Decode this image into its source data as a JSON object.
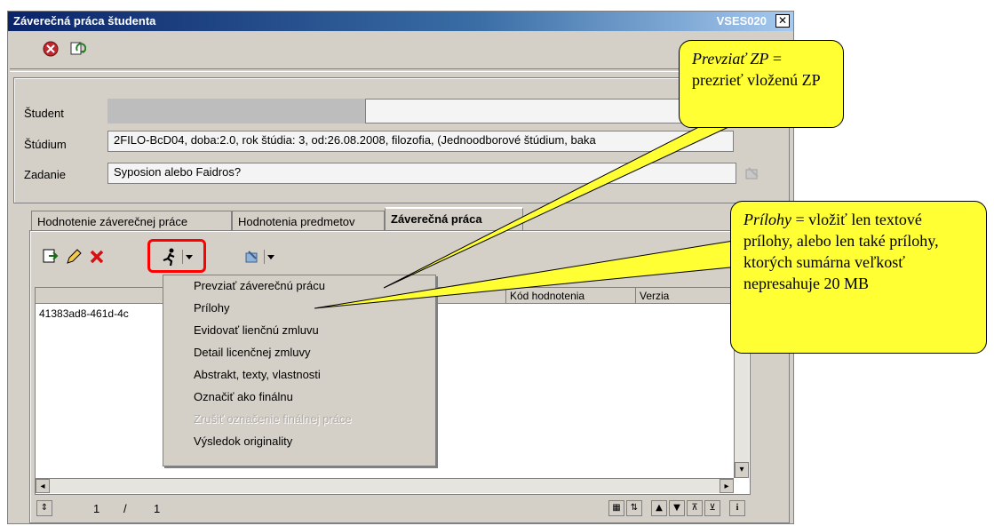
{
  "window": {
    "title": "Záverečná práca študenta",
    "code": "VSES020",
    "close_glyph": "✕"
  },
  "form": {
    "student_label": "Študent",
    "student_value": "",
    "studium_label": "Štúdium",
    "studium_value": "2FILO-BcD04, doba:2.0, rok štúdia: 3, od:26.08.2008, filozofia, (Jednoodborové štúdium, baka",
    "zadanie_label": "Zadanie",
    "zadanie_value": "Syposion alebo Faidros?"
  },
  "tabs": [
    {
      "label": "Hodnotenie záverečnej práce"
    },
    {
      "label": "Hodnotenia predmetov"
    },
    {
      "label": "Záverečná práca"
    }
  ],
  "grid": {
    "headers": [
      "",
      "ráce",
      "Kód hodnotenia",
      "Verzia"
    ],
    "row_value": "41383ad8-461d-4c"
  },
  "menu": {
    "items": [
      {
        "label": "Prevziať záverečnú prácu",
        "enabled": true
      },
      {
        "label": "Prílohy",
        "enabled": true
      },
      {
        "label": "Evidovať lienčnú zmluvu",
        "enabled": true
      },
      {
        "label": "Detail licenčnej zmluvy",
        "enabled": true
      },
      {
        "label": "Abstrakt, texty, vlastnosti",
        "enabled": true
      },
      {
        "label": "Označiť ako finálnu",
        "enabled": true
      },
      {
        "label": "Zrušiť označenie finálnej práce",
        "enabled": false
      },
      {
        "label": "Výsledok originality",
        "enabled": true
      }
    ]
  },
  "statusbar": {
    "current": "1",
    "sep": "/",
    "total": "1"
  },
  "callouts": {
    "top_em": "Prevziať ZP",
    "top_rest": " =",
    "top_line2": "prezrieť vloženú ZP",
    "right_em": "Prílohy",
    "right_rest": " = vložiť len textové prílohy, alebo len také prílohy, ktorých sumárna veľkosť nepresahuje 20 MB"
  },
  "colors": {
    "highlight": "#ff0000",
    "callout": "#ffff33",
    "titlebar": "#0a246a"
  }
}
